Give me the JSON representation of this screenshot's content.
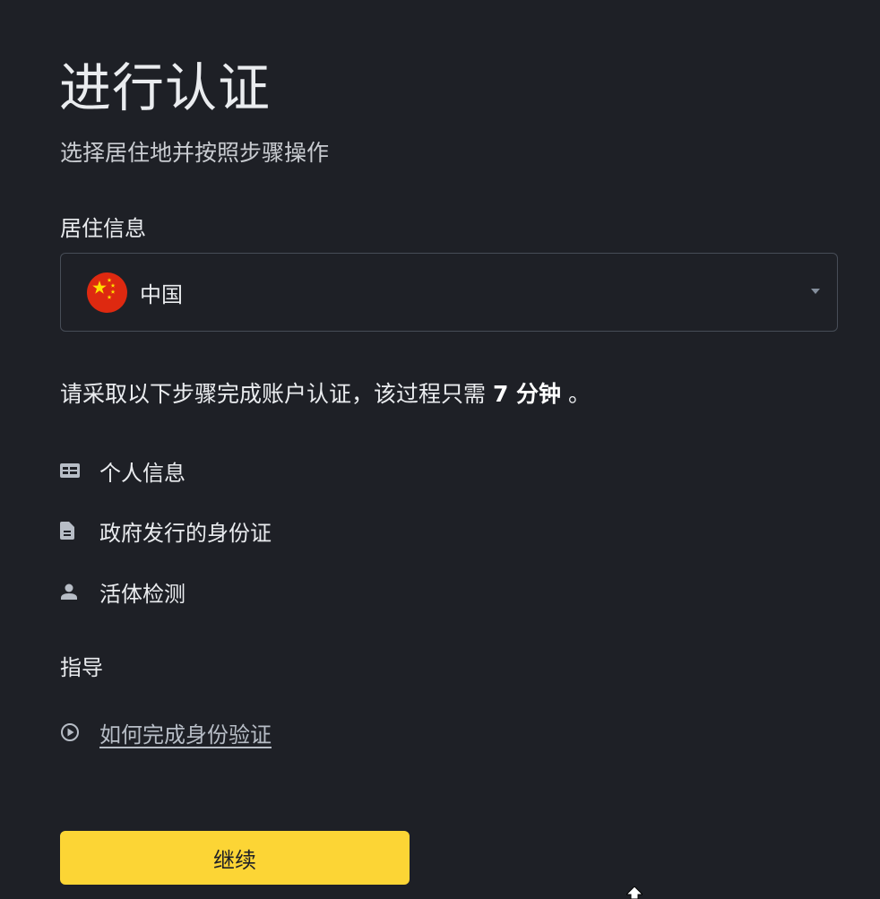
{
  "header": {
    "title": "进行认证",
    "subtitle": "选择居住地并按照步骤操作"
  },
  "residence": {
    "label": "居住信息",
    "selected_country": "中国",
    "flag_icon": "china-flag-icon",
    "dropdown_icon": "caret-down-icon"
  },
  "intro": {
    "text_prefix": "请采取以下步骤完成账户认证，该过程只需 ",
    "duration": "7 分钟",
    "text_suffix": " 。"
  },
  "steps": [
    {
      "icon": "id-card-icon",
      "label": "个人信息"
    },
    {
      "icon": "document-icon",
      "label": "政府发行的身份证"
    },
    {
      "icon": "person-icon",
      "label": "活体检测"
    }
  ],
  "guide": {
    "label": "指导",
    "link_icon": "play-circle-icon",
    "link_text": "如何完成身份验证"
  },
  "actions": {
    "continue_label": "继续"
  },
  "colors": {
    "background": "#1e2026",
    "accent": "#fcd535",
    "border": "#474d57",
    "flag_red": "#de2910",
    "flag_yellow": "#ffde00"
  }
}
